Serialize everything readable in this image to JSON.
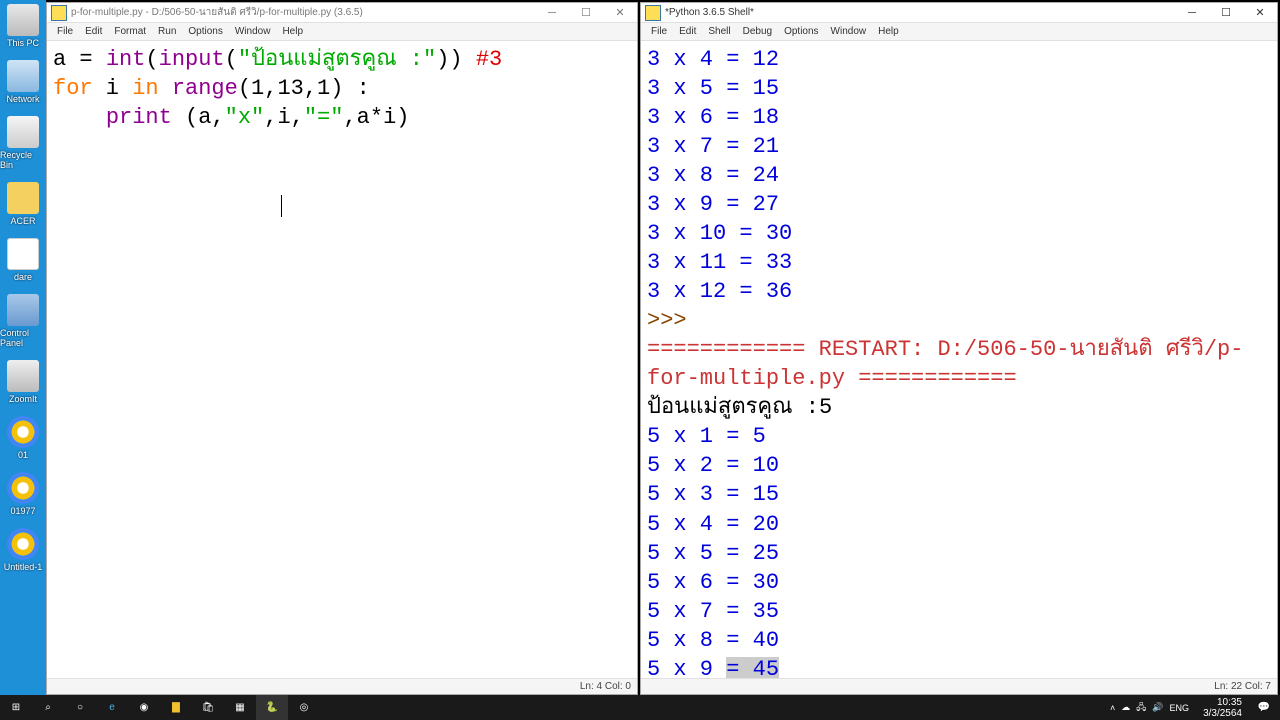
{
  "desktop": {
    "items": [
      {
        "label": "This PC",
        "cls": "pc"
      },
      {
        "label": "Network",
        "cls": "net"
      },
      {
        "label": "Recycle Bin",
        "cls": "bin"
      },
      {
        "label": "ACER",
        "cls": "acer"
      },
      {
        "label": "dare",
        "cls": "dare"
      },
      {
        "label": "Control Panel",
        "cls": "cp"
      },
      {
        "label": "ZoomIt",
        "cls": "zoom"
      },
      {
        "label": "01",
        "cls": "chrome"
      },
      {
        "label": "01977",
        "cls": "chrome"
      },
      {
        "label": "Untitled-1",
        "cls": "chrome"
      }
    ]
  },
  "editor": {
    "title": "p-for-multiple.py - D:/506-50-นายสันติ ศรีวิ/p-for-multiple.py (3.6.5)",
    "menu": [
      "File",
      "Edit",
      "Format",
      "Run",
      "Options",
      "Window",
      "Help"
    ],
    "code": {
      "l1": {
        "var": "a",
        "eq": " = ",
        "fn": "int",
        "op1": "(",
        "fn2": "input",
        "op2": "(",
        "str": "\"ป้อนแม่สูตรคูณ :\"",
        "op3": ")) ",
        "com": "#3"
      },
      "l2": {
        "kw1": "for",
        "var": " i ",
        "kw2": "in",
        "fn": " range",
        "args": "(1,13,1) :"
      },
      "l3": {
        "indent": "    ",
        "fn": "print ",
        "args1": "(a,",
        "str1": "\"x\"",
        "args2": ",i,",
        "str2": "\"=\"",
        "args3": ",a*i)"
      }
    },
    "status": "Ln: 4   Col: 0"
  },
  "shell": {
    "title": "*Python 3.6.5 Shell*",
    "menu": [
      "File",
      "Edit",
      "Shell",
      "Debug",
      "Options",
      "Window",
      "Help"
    ],
    "out3": [
      "3 x 4 = 12",
      "3 x 5 = 15",
      "3 x 6 = 18",
      "3 x 7 = 21",
      "3 x 8 = 24",
      "3 x 9 = 27",
      "3 x 10 = 30",
      "3 x 11 = 33",
      "3 x 12 = 36"
    ],
    "prompt": ">>> ",
    "restart1": "============ RESTART: D:/506-50-นายสันติ  ศรีวิ/p-",
    "restart2": "for-multiple.py ============",
    "input_line": {
      "prompt": "ป้อนแม่สูตรคูณ :",
      "val": "5"
    },
    "out5": [
      "5 x 1 = 5",
      "5 x 2 = 10",
      "5 x 3 = 15",
      "5 x 4 = 20",
      "5 x 5 = 25",
      "5 x 6 = 30",
      "5 x 7 = 35",
      "5 x 8 = 40"
    ],
    "out5_last": {
      "a": "5 x 9 ",
      "b": "= 45"
    },
    "status": "Ln: 22   Col: 7"
  },
  "taskbar": {
    "lang": "ENG",
    "time": "10:35",
    "date": "3/3/2564"
  }
}
